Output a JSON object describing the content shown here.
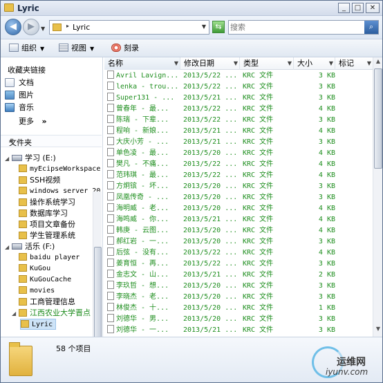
{
  "window": {
    "title": "Lyric",
    "min": "_",
    "max": "□",
    "close": "✕"
  },
  "address": {
    "path": "Lyric",
    "search_placeholder": "搜索"
  },
  "toolbar": {
    "organize": "组织",
    "views": "视图",
    "burn": "刻录"
  },
  "favorites": {
    "title": "收藏夹链接",
    "items": [
      "文档",
      "图片",
      "音乐"
    ],
    "more": "更多",
    "more_arrow": "»"
  },
  "tree": {
    "header": "文件夹",
    "items": [
      {
        "label": "学习 (E:)",
        "kind": "drive"
      },
      {
        "label": "myEcipseWorkspace",
        "kind": "folder"
      },
      {
        "label": "SSH视频",
        "kind": "folder"
      },
      {
        "label": "windows server 20",
        "kind": "folder"
      },
      {
        "label": "操作系统学习",
        "kind": "folder"
      },
      {
        "label": "数据库学习",
        "kind": "folder"
      },
      {
        "label": "项目文章备份",
        "kind": "folder"
      },
      {
        "label": "学生管理系统",
        "kind": "folder"
      },
      {
        "label": "活乐 (F:)",
        "kind": "drive"
      },
      {
        "label": "baidu player",
        "kind": "folder"
      },
      {
        "label": "KuGou",
        "kind": "folder"
      },
      {
        "label": "KuGouCache",
        "kind": "folder"
      },
      {
        "label": "movies",
        "kind": "folder"
      },
      {
        "label": "工商管理信息",
        "kind": "folder"
      },
      {
        "label": "江西农业大学晋点",
        "kind": "folder"
      },
      {
        "label": "Lyric",
        "kind": "folder"
      }
    ]
  },
  "columns": [
    "名称",
    "修改日期",
    "类型",
    "大小",
    "标记"
  ],
  "files": [
    {
      "name": "Avril Lavign...",
      "date": "2013/5/22 ...",
      "type": "KRC 文件",
      "size": "3 KB"
    },
    {
      "name": "lenka - trou...",
      "date": "2013/5/22 ...",
      "type": "KRC 文件",
      "size": "3 KB"
    },
    {
      "name": "Super131 - ...",
      "date": "2013/5/21 ...",
      "type": "KRC 文件",
      "size": "3 KB"
    },
    {
      "name": "曾春年 - 最...",
      "date": "2013/5/22 ...",
      "type": "KRC 文件",
      "size": "4 KB"
    },
    {
      "name": "陈瑞 - 下辈...",
      "date": "2013/5/22 ...",
      "type": "KRC 文件",
      "size": "3 KB"
    },
    {
      "name": "程响 - 新娘...",
      "date": "2013/5/21 ...",
      "type": "KRC 文件",
      "size": "4 KB"
    },
    {
      "name": "大庆小芳 - ...",
      "date": "2013/5/21 ...",
      "type": "KRC 文件",
      "size": "3 KB"
    },
    {
      "name": "单色凌 - 最...",
      "date": "2013/5/20 ...",
      "type": "KRC 文件",
      "size": "4 KB"
    },
    {
      "name": "樊凡 - 不痛...",
      "date": "2013/5/22 ...",
      "type": "KRC 文件",
      "size": "4 KB"
    },
    {
      "name": "范玮琪 - 最...",
      "date": "2013/5/22 ...",
      "type": "KRC 文件",
      "size": "4 KB"
    },
    {
      "name": "方炯镔 - 坏...",
      "date": "2013/5/20 ...",
      "type": "KRC 文件",
      "size": "3 KB"
    },
    {
      "name": "凤凰传奇 - ...",
      "date": "2013/5/20 ...",
      "type": "KRC 文件",
      "size": "3 KB"
    },
    {
      "name": "海明威 - 老...",
      "date": "2013/5/20 ...",
      "type": "KRC 文件",
      "size": "4 KB"
    },
    {
      "name": "海鸣威 - 你...",
      "date": "2013/5/21 ...",
      "type": "KRC 文件",
      "size": "4 KB"
    },
    {
      "name": "韩庚 - 云图...",
      "date": "2013/5/20 ...",
      "type": "KRC 文件",
      "size": "4 KB"
    },
    {
      "name": "郝红岩 - 一...",
      "date": "2013/5/20 ...",
      "type": "KRC 文件",
      "size": "3 KB"
    },
    {
      "name": "后弦 - 没有...",
      "date": "2013/5/22 ...",
      "type": "KRC 文件",
      "size": "4 KB"
    },
    {
      "name": "姜育恒 - 再...",
      "date": "2013/5/22 ...",
      "type": "KRC 文件",
      "size": "3 KB"
    },
    {
      "name": "金志文 - 山...",
      "date": "2013/5/21 ...",
      "type": "KRC 文件",
      "size": "2 KB"
    },
    {
      "name": "李玖哲 - 想...",
      "date": "2013/5/20 ...",
      "type": "KRC 文件",
      "size": "3 KB"
    },
    {
      "name": "李晓杰 - 老...",
      "date": "2013/5/20 ...",
      "type": "KRC 文件",
      "size": "3 KB"
    },
    {
      "name": "林俊杰 - 十...",
      "date": "2013/5/20 ...",
      "type": "KRC 文件",
      "size": "1 KB"
    },
    {
      "name": "刘德华 - 男...",
      "date": "2013/5/20 ...",
      "type": "KRC 文件",
      "size": "3 KB"
    },
    {
      "name": "刘德华 - 一...",
      "date": "2013/5/21 ...",
      "type": "KRC 文件",
      "size": "3 KB"
    }
  ],
  "details": {
    "count": "58 个项目"
  },
  "watermark": {
    "cn": "运维网",
    "en": "iyunv.com"
  },
  "colors": {
    "file_text": "#1e8e1e",
    "accent": "#2f67a8"
  }
}
